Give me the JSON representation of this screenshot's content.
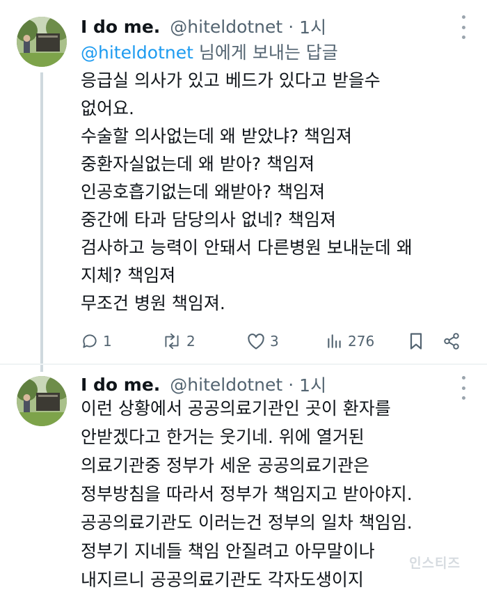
{
  "tweet1": {
    "name": "I do me.",
    "handle": "@hiteldotnet",
    "dot": "·",
    "time": "1시",
    "reply_mention": "@hiteldotnet",
    "reply_rest": " 님에게 보내는 답글",
    "lines": [
      "응급실 의사가 있고 베드가 있다고 받을수",
      "없어요.",
      "수술할 의사없는데 왜 받았냐? 책임져",
      "중환자실없는데 왜 받아? 책임져",
      "인공호흡기없는데 왜받아? 책임져",
      "중간에 타과 담당의사 없네? 책임져",
      "검사하고 능력이 안돼서 다른병원 보내눈데 왜",
      "지체? 책임져",
      "무조건 병원 책임져."
    ],
    "actions": {
      "replies": "1",
      "reposts": "2",
      "likes": "3",
      "views": "276"
    }
  },
  "tweet2": {
    "name": "I do me.",
    "handle": "@hiteldotnet",
    "dot": "·",
    "time": "1시",
    "lines": [
      "이런 상황에서 공공의료기관인 곳이 환자를",
      "안받겠다고 한거는 웃기네. 위에 열거된",
      "의료기관중 정부가 세운 공공의료기관은",
      "정부방침을 따라서 정부가 책임지고 받아야지.",
      "공공의료기관도 이러는건 정부의 일차 책임임.",
      "정부기 지네들 책임 안질려고 아무말이나",
      "내지르니 공공의료기관도 각자도생이지"
    ]
  },
  "watermark": "인스티즈",
  "icons": {
    "more": "more-vertical-icon",
    "reply": "reply-icon",
    "repost": "repost-icon",
    "like": "heart-icon",
    "views": "views-icon",
    "bookmark": "bookmark-icon",
    "share": "share-icon"
  },
  "colors": {
    "text": "#0f1419",
    "secondary": "#536471",
    "link": "#1d9bf0",
    "thread_line": "#cfd9de"
  }
}
